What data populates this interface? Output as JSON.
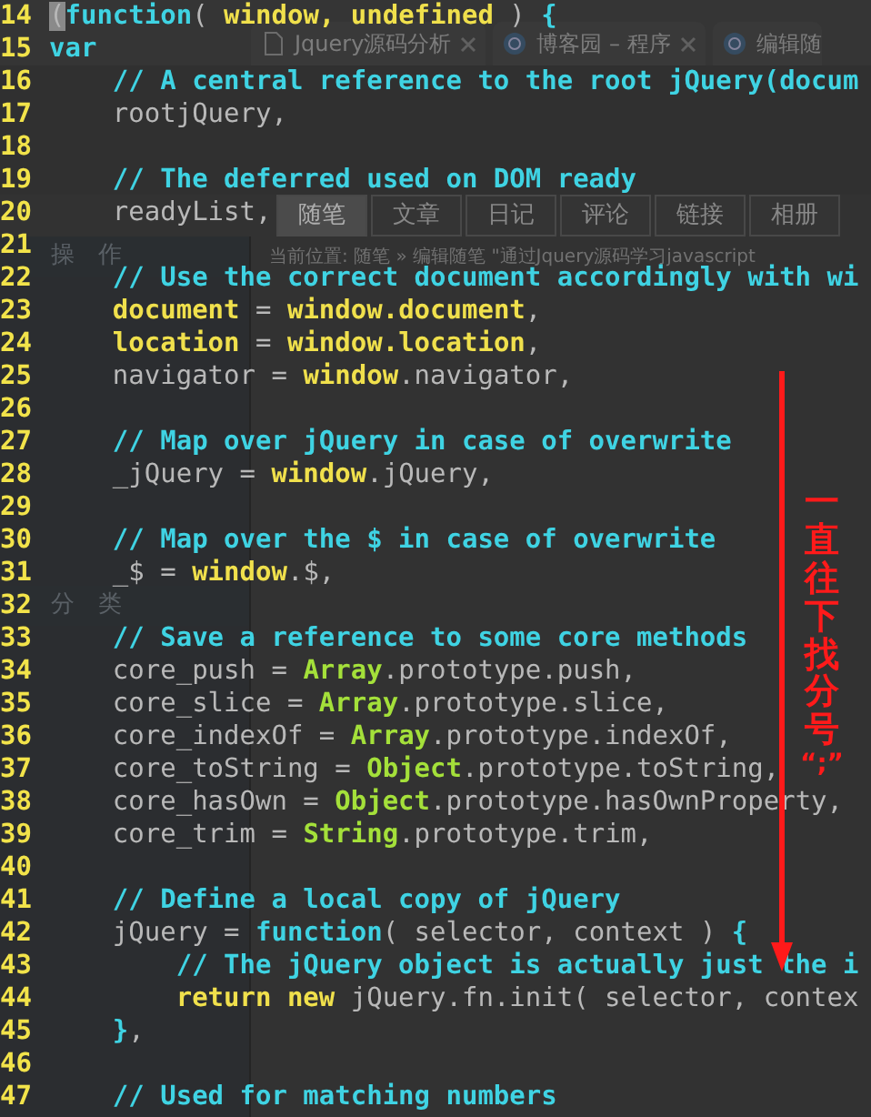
{
  "browser_tabs": [
    {
      "title": "Jquery源码分析"
    },
    {
      "title": "博客园 – 程序"
    },
    {
      "title": "编辑随"
    }
  ],
  "blog_tabs": [
    {
      "label": "随笔",
      "selected": true
    },
    {
      "label": "文章",
      "selected": false
    },
    {
      "label": "日记",
      "selected": false
    },
    {
      "label": "评论",
      "selected": false
    },
    {
      "label": "链接",
      "selected": false
    },
    {
      "label": "相册",
      "selected": false
    }
  ],
  "sidebar": {
    "sections": [
      {
        "heading": "操　作"
      },
      {
        "heading": "分　类"
      }
    ]
  },
  "breadcrumb": "当前位置: 随笔 » 编辑随笔 \"通过Jquery源码学习javascript",
  "editor": {
    "lines": [
      {
        "number": "14",
        "tokens": [
          {
            "kind": "cursor",
            "text": "("
          },
          {
            "kind": "keyword",
            "text": "function"
          },
          {
            "kind": "plain",
            "text": "( "
          },
          {
            "kind": "variable",
            "text": "window, undefined"
          },
          {
            "kind": "plain",
            "text": " ) "
          },
          {
            "kind": "keyword",
            "text": "{"
          }
        ]
      },
      {
        "number": "15",
        "tokens": [
          {
            "kind": "keyword",
            "text": "var"
          }
        ]
      },
      {
        "number": "16",
        "tokens": [
          {
            "kind": "comment",
            "text": "    // A central reference to the root jQuery(docum"
          }
        ]
      },
      {
        "number": "17",
        "tokens": [
          {
            "kind": "plain",
            "text": "    rootjQuery,"
          }
        ]
      },
      {
        "number": "18"
      },
      {
        "number": "19",
        "tokens": [
          {
            "kind": "comment",
            "text": "    // The deferred used on DOM ready"
          }
        ]
      },
      {
        "number": "20",
        "tokens": [
          {
            "kind": "plain",
            "text": "    readyList,"
          }
        ]
      },
      {
        "number": "21"
      },
      {
        "number": "22",
        "tokens": [
          {
            "kind": "comment",
            "text": "    // Use the correct document accordingly with wi"
          }
        ]
      },
      {
        "number": "23",
        "tokens": [
          {
            "kind": "variable",
            "text": "    document"
          },
          {
            "kind": "plain",
            "text": " = "
          },
          {
            "kind": "variable",
            "text": "window.document"
          },
          {
            "kind": "plain",
            "text": ","
          }
        ]
      },
      {
        "number": "24",
        "tokens": [
          {
            "kind": "variable",
            "text": "    location"
          },
          {
            "kind": "plain",
            "text": " = "
          },
          {
            "kind": "variable",
            "text": "window.location"
          },
          {
            "kind": "plain",
            "text": ","
          }
        ]
      },
      {
        "number": "25",
        "tokens": [
          {
            "kind": "plain",
            "text": "    navigator = "
          },
          {
            "kind": "variable",
            "text": "window"
          },
          {
            "kind": "plain",
            "text": ".navigator,"
          }
        ]
      },
      {
        "number": "26"
      },
      {
        "number": "27",
        "tokens": [
          {
            "kind": "comment",
            "text": "    // Map over jQuery in case of overwrite"
          }
        ]
      },
      {
        "number": "28",
        "tokens": [
          {
            "kind": "plain",
            "text": "    _jQuery = "
          },
          {
            "kind": "variable",
            "text": "window"
          },
          {
            "kind": "plain",
            "text": ".jQuery,"
          }
        ]
      },
      {
        "number": "29"
      },
      {
        "number": "30",
        "tokens": [
          {
            "kind": "comment",
            "text": "    // Map over the $ in case of overwrite"
          }
        ]
      },
      {
        "number": "31",
        "tokens": [
          {
            "kind": "plain",
            "text": "    _$ = "
          },
          {
            "kind": "variable",
            "text": "window"
          },
          {
            "kind": "plain",
            "text": ".$,"
          }
        ]
      },
      {
        "number": "32"
      },
      {
        "number": "33",
        "tokens": [
          {
            "kind": "comment",
            "text": "    // Save a reference to some core methods"
          }
        ]
      },
      {
        "number": "34",
        "tokens": [
          {
            "kind": "plain",
            "text": "    core_push = "
          },
          {
            "kind": "builtin",
            "text": "Array"
          },
          {
            "kind": "plain",
            "text": ".prototype.push,"
          }
        ]
      },
      {
        "number": "35",
        "tokens": [
          {
            "kind": "plain",
            "text": "    core_slice = "
          },
          {
            "kind": "builtin",
            "text": "Array"
          },
          {
            "kind": "plain",
            "text": ".prototype.slice,"
          }
        ]
      },
      {
        "number": "36",
        "tokens": [
          {
            "kind": "plain",
            "text": "    core_indexOf = "
          },
          {
            "kind": "builtin",
            "text": "Array"
          },
          {
            "kind": "plain",
            "text": ".prototype.indexOf,"
          }
        ]
      },
      {
        "number": "37",
        "tokens": [
          {
            "kind": "plain",
            "text": "    core_toString = "
          },
          {
            "kind": "builtin",
            "text": "Object"
          },
          {
            "kind": "plain",
            "text": ".prototype.toString,"
          }
        ]
      },
      {
        "number": "38",
        "tokens": [
          {
            "kind": "plain",
            "text": "    core_hasOwn = "
          },
          {
            "kind": "builtin",
            "text": "Object"
          },
          {
            "kind": "plain",
            "text": ".prototype.hasOwnProperty,"
          }
        ]
      },
      {
        "number": "39",
        "tokens": [
          {
            "kind": "plain",
            "text": "    core_trim = "
          },
          {
            "kind": "builtin",
            "text": "String"
          },
          {
            "kind": "plain",
            "text": ".prototype.trim,"
          }
        ]
      },
      {
        "number": "40"
      },
      {
        "number": "41",
        "tokens": [
          {
            "kind": "comment",
            "text": "    // Define a local copy of jQuery"
          }
        ]
      },
      {
        "number": "42",
        "tokens": [
          {
            "kind": "plain",
            "text": "    jQuery = "
          },
          {
            "kind": "keyword",
            "text": "function"
          },
          {
            "kind": "plain",
            "text": "( selector, context ) "
          },
          {
            "kind": "keyword",
            "text": "{"
          }
        ]
      },
      {
        "number": "43",
        "tokens": [
          {
            "kind": "comment",
            "text": "        // The jQuery object is actually just the i"
          }
        ]
      },
      {
        "number": "44",
        "tokens": [
          {
            "kind": "variable",
            "text": "        return new"
          },
          {
            "kind": "plain",
            "text": " jQuery.fn.init( selector, contex"
          }
        ]
      },
      {
        "number": "45",
        "tokens": [
          {
            "kind": "keyword",
            "text": "    }"
          },
          {
            "kind": "plain",
            "text": ","
          }
        ]
      },
      {
        "number": "46"
      },
      {
        "number": "47",
        "tokens": [
          {
            "kind": "comment",
            "text": "    // Used for matching numbers"
          }
        ]
      }
    ]
  },
  "annotation": {
    "text": "一直往下找分号",
    "mark": "“;”"
  }
}
